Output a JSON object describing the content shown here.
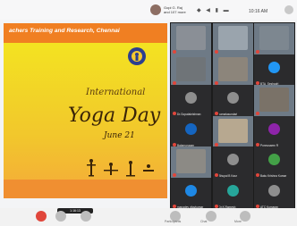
{
  "status_bar": {
    "presenter_line1": "Gopi G. Raj",
    "presenter_line2": "and 107 more",
    "time": "10:16 AM",
    "icons": [
      "lock-icon",
      "volume-icon",
      "signal-icon",
      "battery-icon"
    ]
  },
  "slide": {
    "header_text": "achers Training and Research, Chennai",
    "title_line1": "International",
    "title_line2": "Yoga Day",
    "title_line3": "June 21",
    "colors": {
      "header": "#f07f22",
      "background": "#f3e321"
    }
  },
  "participants": [
    {
      "name": "",
      "video": true,
      "color": "#8a8f96"
    },
    {
      "name": "",
      "video": true,
      "color": "#9aa4ad"
    },
    {
      "name": "",
      "video": true,
      "color": "#7d8790"
    },
    {
      "name": "",
      "video": true,
      "color": "#6f7478"
    },
    {
      "name": "",
      "video": true,
      "color": "#8c857b"
    },
    {
      "name": "BTA_Seshadri",
      "video": false,
      "color": "#2196f3"
    },
    {
      "name": "Dr.Gopalakrishnan",
      "video": false,
      "color": "#8e8e8e"
    },
    {
      "name": "kamalasundari",
      "video": false,
      "color": "#8e8e8e"
    },
    {
      "name": "",
      "video": true,
      "color": "#7a7268"
    },
    {
      "name": "Balamurugan",
      "video": false,
      "color": "#1565c0"
    },
    {
      "name": "",
      "video": true,
      "color": "#b7a890"
    },
    {
      "name": "Ponnusamy R",
      "video": false,
      "color": "#8e24aa"
    },
    {
      "name": "",
      "video": true,
      "color": "#8c8a85"
    },
    {
      "name": "Bhupal B Kaur",
      "video": false,
      "color": "#8e8e8e"
    },
    {
      "name": "Baku Krishna Kumar",
      "video": false,
      "color": "#43a047"
    },
    {
      "name": "manadev vijaykumar",
      "video": false,
      "color": "#1e88e5"
    },
    {
      "name": "Dr.K.Ramesh",
      "video": false,
      "color": "#26a69a"
    },
    {
      "name": "ATC Kumaran",
      "video": false,
      "color": "#8e8e8e"
    }
  ],
  "controls": {
    "caption_chip": "1:16:13",
    "buttons": [
      {
        "name": "mic-button",
        "icon": "mic-icon",
        "color": "#e0463b",
        "label": ""
      },
      {
        "name": "camera-button",
        "icon": "camera-icon",
        "color": "#bdbdbd",
        "label": ""
      },
      {
        "name": "share-button",
        "icon": "share-icon",
        "color": "#bdbdbd",
        "label": ""
      },
      {
        "name": "participants-button",
        "icon": "people-icon",
        "color": "#bdbdbd",
        "label": "Participants"
      },
      {
        "name": "chat-button",
        "icon": "chat-icon",
        "color": "#bdbdbd",
        "label": "Chat"
      },
      {
        "name": "more-button",
        "icon": "more-icon",
        "color": "#bdbdbd",
        "label": "More"
      }
    ]
  }
}
